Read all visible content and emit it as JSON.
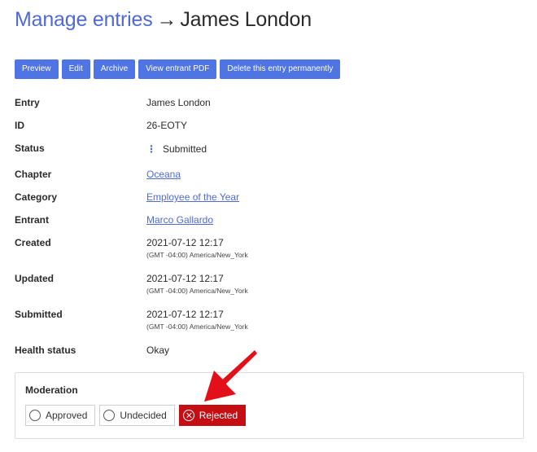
{
  "header": {
    "breadcrumb": "Manage entries",
    "arrow": "→",
    "title": "James London"
  },
  "toolbar": {
    "preview": "Preview",
    "edit": "Edit",
    "archive": "Archive",
    "view_pdf": "View entrant PDF",
    "delete": "Delete this entry permanently"
  },
  "details": {
    "entry": {
      "label": "Entry",
      "value": "James London"
    },
    "id": {
      "label": "ID",
      "value": "26-EOTY"
    },
    "status": {
      "label": "Status",
      "icon": "⋮",
      "value": "Submitted"
    },
    "chapter": {
      "label": "Chapter",
      "value": "Oceana"
    },
    "category": {
      "label": "Category",
      "value": "Employee of the Year"
    },
    "entrant": {
      "label": "Entrant",
      "value": "Marco Gallardo"
    },
    "created": {
      "label": "Created",
      "value": "2021-07-12 12:17",
      "tz": "(GMT -04:00) America/New_York"
    },
    "updated": {
      "label": "Updated",
      "value": "2021-07-12 12:17",
      "tz": "(GMT -04:00) America/New_York"
    },
    "submitted": {
      "label": "Submitted",
      "value": "2021-07-12 12:17",
      "tz": "(GMT -04:00) America/New_York"
    },
    "health": {
      "label": "Health status",
      "value": "Okay"
    }
  },
  "moderation": {
    "heading": "Moderation",
    "options": [
      "Approved",
      "Undecided",
      "Rejected"
    ],
    "selected": "Rejected"
  },
  "colors": {
    "link": "#4f6ad8",
    "button": "#4f74e3",
    "rejected": "#c40e14",
    "annotation_arrow": "#e3101a"
  },
  "icons": {
    "status": "kebab-menu-icon",
    "rejected": "x-circle-icon",
    "annotation": "red-arrow-icon"
  }
}
